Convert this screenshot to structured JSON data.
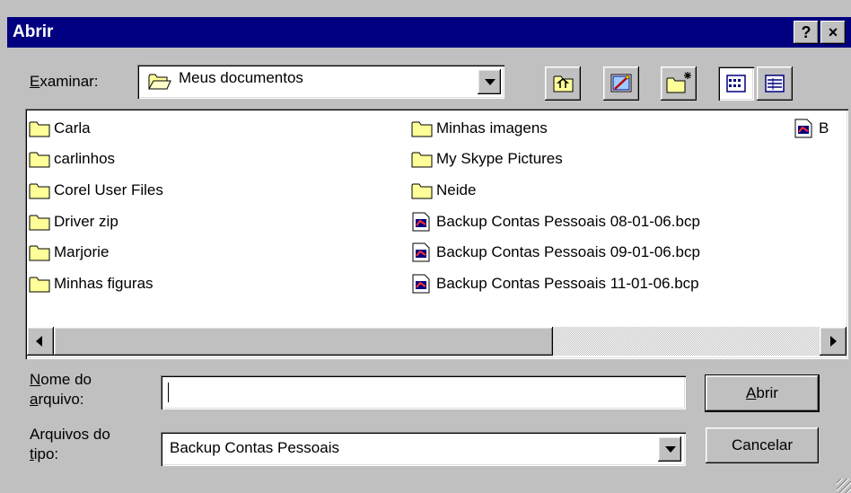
{
  "window": {
    "title": "Abrir",
    "help_label": "?",
    "close_label": "×"
  },
  "look_in": {
    "label_prefix": "E",
    "label_rest": "xaminar:",
    "value": "Meus documentos"
  },
  "files": [
    {
      "name": "Carla",
      "type": "folder"
    },
    {
      "name": "carlinhos",
      "type": "folder"
    },
    {
      "name": "Corel User Files",
      "type": "folder"
    },
    {
      "name": "Driver zip",
      "type": "folder"
    },
    {
      "name": "Marjorie",
      "type": "folder"
    },
    {
      "name": "Minhas figuras",
      "type": "folder"
    },
    {
      "name": "Minhas imagens",
      "type": "folder"
    },
    {
      "name": "My Skype Pictures",
      "type": "folder"
    },
    {
      "name": "Neide",
      "type": "folder"
    },
    {
      "name": "Backup Contas Pessoais 08-01-06.bcp",
      "type": "file"
    },
    {
      "name": "Backup Contas Pessoais 09-01-06.bcp",
      "type": "file"
    },
    {
      "name": "Backup Contas Pessoais 11-01-06.bcp",
      "type": "file"
    },
    {
      "name": "B",
      "type": "file"
    }
  ],
  "filename": {
    "label_line1_prefix": "N",
    "label_line1_rest": "ome do",
    "label_line2_prefix": "a",
    "label_line2_rest": "rquivo:",
    "value": ""
  },
  "filetype": {
    "label_line1": "Arquivos do",
    "label_line2_prefix": "t",
    "label_line2_rest": "ipo:",
    "value": "Backup Contas Pessoais"
  },
  "buttons": {
    "open_prefix": "A",
    "open_rest": "brir",
    "cancel": "Cancelar"
  },
  "colors": {
    "titlebar": "#000080",
    "face": "#c0c0c0",
    "folder": "#ffff99"
  }
}
